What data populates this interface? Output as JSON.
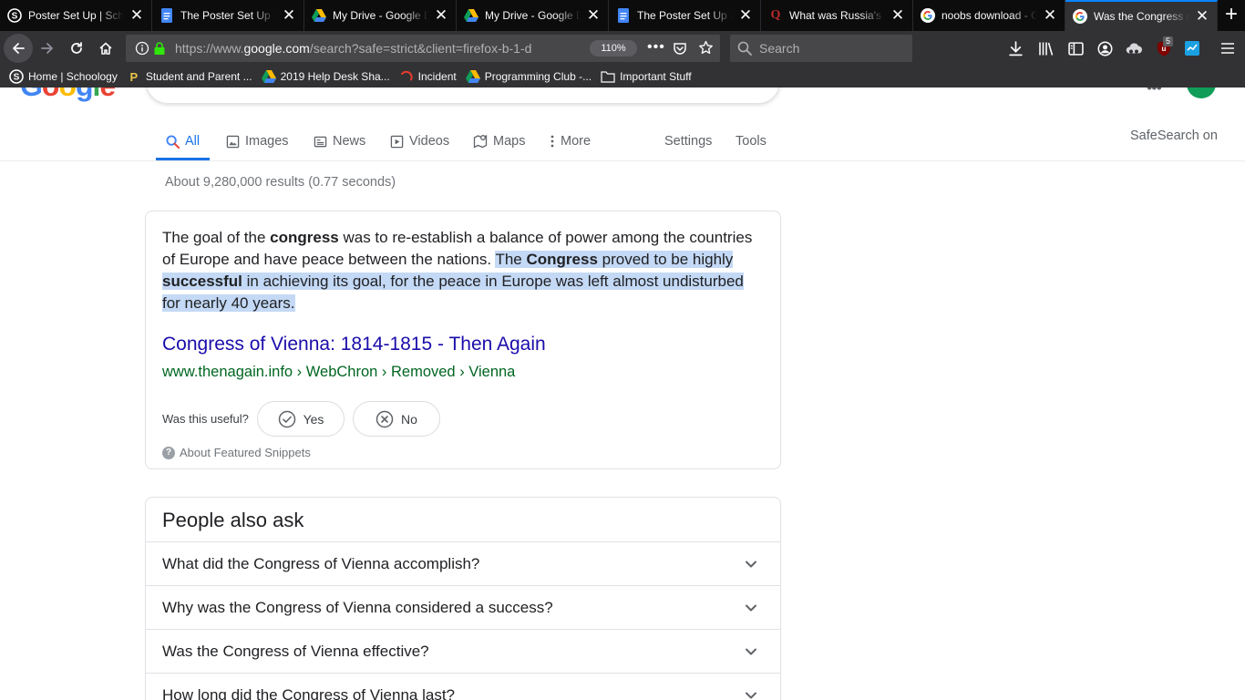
{
  "browser": {
    "tabs": [
      {
        "title": "Poster Set Up | Schoology",
        "icon": "schoology-icon"
      },
      {
        "title": "The Poster Set Up - Google Docs",
        "icon": "google-docs-icon"
      },
      {
        "title": "My Drive - Google Drive",
        "icon": "google-drive-icon"
      },
      {
        "title": "My Drive - Google Drive",
        "icon": "google-drive-icon"
      },
      {
        "title": "The Poster Set Up - Google Docs",
        "icon": "google-docs-icon"
      },
      {
        "title": "What was Russia's goal",
        "icon": "quora-icon"
      },
      {
        "title": "noobs download - Google Search",
        "icon": "google-icon"
      },
      {
        "title": "Was the Congress of Vienna successful",
        "icon": "google-icon",
        "active": true
      }
    ],
    "url_prefix": "https://www.",
    "url_domain": "google.com",
    "url_rest": "/search?safe=strict&client=firefox-b-1-d",
    "zoom": "110%",
    "search_placeholder": "Search",
    "extension_badge": "5",
    "bookmarks": [
      {
        "label": "Home | Schoology",
        "icon": "schoology-icon"
      },
      {
        "label": "Student and Parent ...",
        "icon": "student-portal-icon"
      },
      {
        "label": "2019 Help Desk Sha...",
        "icon": "google-drive-icon"
      },
      {
        "label": "Incident",
        "icon": "incident-icon"
      },
      {
        "label": "Programming Club -...",
        "icon": "google-drive-icon"
      },
      {
        "label": "Important Stuff",
        "icon": "folder-icon"
      }
    ]
  },
  "search_tabs": {
    "all": "All",
    "images": "Images",
    "news": "News",
    "videos": "Videos",
    "maps": "Maps",
    "more": "More",
    "settings": "Settings",
    "tools": "Tools"
  },
  "safesearch": "SafeSearch on",
  "result_stats": "About 9,280,000 results (0.77 seconds)",
  "featured_snippet": {
    "t1": "The goal of the ",
    "b1": "congress",
    "t2": " was to re-establish a balance of power among the countries of Europe and have peace between the nations. ",
    "h1": "The ",
    "hb1": "Congress",
    "h2": " proved to be highly ",
    "hb2": "successful",
    "h3": " in achieving its goal, for the peace in Europe was left almost undisturbed for nearly 40 years.",
    "link_title": "Congress of Vienna: 1814-1815 - Then Again",
    "cite": "www.thenagain.info › WebChron › Removed › Vienna",
    "useful_label": "Was this useful?",
    "yes_label": "Yes",
    "no_label": "No",
    "about_label": "About Featured Snippets"
  },
  "people_also_ask": {
    "title": "People also ask",
    "questions": [
      "What did the Congress of Vienna accomplish?",
      "Why was the Congress of Vienna considered a success?",
      "Was the Congress of Vienna effective?",
      "How long did the Congress of Vienna last?"
    ]
  }
}
